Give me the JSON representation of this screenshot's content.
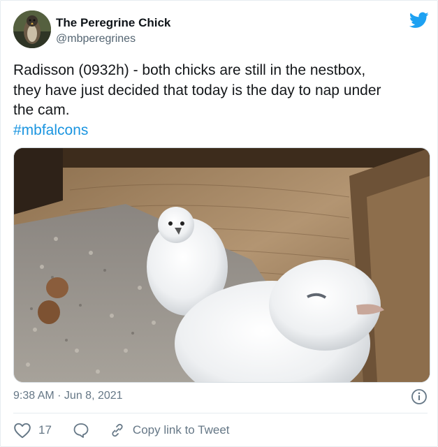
{
  "tweet": {
    "author_name": "The Peregrine Chick",
    "author_handle": "@mbperegrines",
    "text_lines": [
      "Radisson (0932h) - both chicks are still in the nestbox,",
      "they have just decided that today is the day to nap under",
      "the cam."
    ],
    "hashtag": "#mbfalcons",
    "timestamp": "9:38 AM · Jun 8, 2021",
    "like_count": "17",
    "copy_link_label": "Copy link to Tweet"
  },
  "icons": {
    "brand": "twitter-bird-icon",
    "info": "info-icon",
    "like": "heart-icon",
    "reply": "speech-bubble-icon",
    "link": "link-icon"
  },
  "colors": {
    "accent": "#1da1f2",
    "hashtag": "#1b95e0",
    "secondary_text": "#657786"
  }
}
